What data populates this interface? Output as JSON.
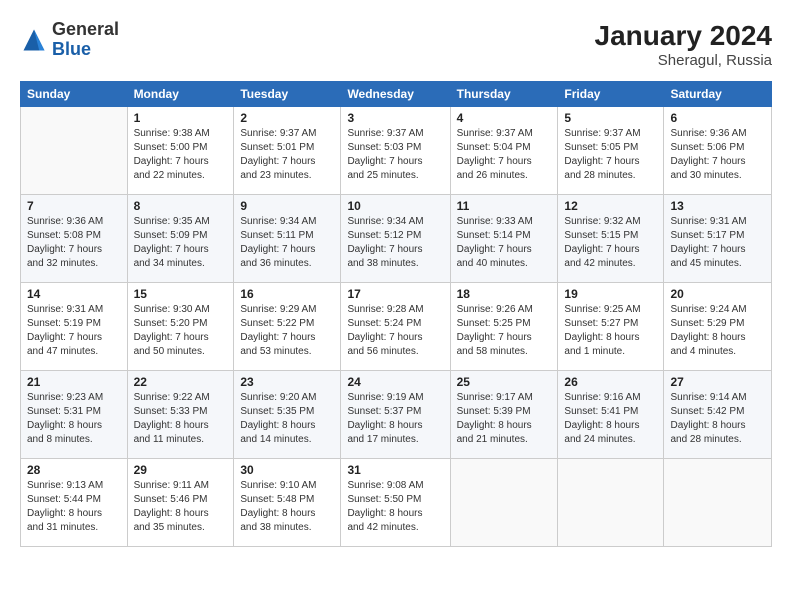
{
  "logo": {
    "general": "General",
    "blue": "Blue"
  },
  "title": "January 2024",
  "location": "Sheragul, Russia",
  "days_header": [
    "Sunday",
    "Monday",
    "Tuesday",
    "Wednesday",
    "Thursday",
    "Friday",
    "Saturday"
  ],
  "weeks": [
    [
      {
        "day": "",
        "info": ""
      },
      {
        "day": "1",
        "info": "Sunrise: 9:38 AM\nSunset: 5:00 PM\nDaylight: 7 hours\nand 22 minutes."
      },
      {
        "day": "2",
        "info": "Sunrise: 9:37 AM\nSunset: 5:01 PM\nDaylight: 7 hours\nand 23 minutes."
      },
      {
        "day": "3",
        "info": "Sunrise: 9:37 AM\nSunset: 5:03 PM\nDaylight: 7 hours\nand 25 minutes."
      },
      {
        "day": "4",
        "info": "Sunrise: 9:37 AM\nSunset: 5:04 PM\nDaylight: 7 hours\nand 26 minutes."
      },
      {
        "day": "5",
        "info": "Sunrise: 9:37 AM\nSunset: 5:05 PM\nDaylight: 7 hours\nand 28 minutes."
      },
      {
        "day": "6",
        "info": "Sunrise: 9:36 AM\nSunset: 5:06 PM\nDaylight: 7 hours\nand 30 minutes."
      }
    ],
    [
      {
        "day": "7",
        "info": "Sunrise: 9:36 AM\nSunset: 5:08 PM\nDaylight: 7 hours\nand 32 minutes."
      },
      {
        "day": "8",
        "info": "Sunrise: 9:35 AM\nSunset: 5:09 PM\nDaylight: 7 hours\nand 34 minutes."
      },
      {
        "day": "9",
        "info": "Sunrise: 9:34 AM\nSunset: 5:11 PM\nDaylight: 7 hours\nand 36 minutes."
      },
      {
        "day": "10",
        "info": "Sunrise: 9:34 AM\nSunset: 5:12 PM\nDaylight: 7 hours\nand 38 minutes."
      },
      {
        "day": "11",
        "info": "Sunrise: 9:33 AM\nSunset: 5:14 PM\nDaylight: 7 hours\nand 40 minutes."
      },
      {
        "day": "12",
        "info": "Sunrise: 9:32 AM\nSunset: 5:15 PM\nDaylight: 7 hours\nand 42 minutes."
      },
      {
        "day": "13",
        "info": "Sunrise: 9:31 AM\nSunset: 5:17 PM\nDaylight: 7 hours\nand 45 minutes."
      }
    ],
    [
      {
        "day": "14",
        "info": "Sunrise: 9:31 AM\nSunset: 5:19 PM\nDaylight: 7 hours\nand 47 minutes."
      },
      {
        "day": "15",
        "info": "Sunrise: 9:30 AM\nSunset: 5:20 PM\nDaylight: 7 hours\nand 50 minutes."
      },
      {
        "day": "16",
        "info": "Sunrise: 9:29 AM\nSunset: 5:22 PM\nDaylight: 7 hours\nand 53 minutes."
      },
      {
        "day": "17",
        "info": "Sunrise: 9:28 AM\nSunset: 5:24 PM\nDaylight: 7 hours\nand 56 minutes."
      },
      {
        "day": "18",
        "info": "Sunrise: 9:26 AM\nSunset: 5:25 PM\nDaylight: 7 hours\nand 58 minutes."
      },
      {
        "day": "19",
        "info": "Sunrise: 9:25 AM\nSunset: 5:27 PM\nDaylight: 8 hours\nand 1 minute."
      },
      {
        "day": "20",
        "info": "Sunrise: 9:24 AM\nSunset: 5:29 PM\nDaylight: 8 hours\nand 4 minutes."
      }
    ],
    [
      {
        "day": "21",
        "info": "Sunrise: 9:23 AM\nSunset: 5:31 PM\nDaylight: 8 hours\nand 8 minutes."
      },
      {
        "day": "22",
        "info": "Sunrise: 9:22 AM\nSunset: 5:33 PM\nDaylight: 8 hours\nand 11 minutes."
      },
      {
        "day": "23",
        "info": "Sunrise: 9:20 AM\nSunset: 5:35 PM\nDaylight: 8 hours\nand 14 minutes."
      },
      {
        "day": "24",
        "info": "Sunrise: 9:19 AM\nSunset: 5:37 PM\nDaylight: 8 hours\nand 17 minutes."
      },
      {
        "day": "25",
        "info": "Sunrise: 9:17 AM\nSunset: 5:39 PM\nDaylight: 8 hours\nand 21 minutes."
      },
      {
        "day": "26",
        "info": "Sunrise: 9:16 AM\nSunset: 5:41 PM\nDaylight: 8 hours\nand 24 minutes."
      },
      {
        "day": "27",
        "info": "Sunrise: 9:14 AM\nSunset: 5:42 PM\nDaylight: 8 hours\nand 28 minutes."
      }
    ],
    [
      {
        "day": "28",
        "info": "Sunrise: 9:13 AM\nSunset: 5:44 PM\nDaylight: 8 hours\nand 31 minutes."
      },
      {
        "day": "29",
        "info": "Sunrise: 9:11 AM\nSunset: 5:46 PM\nDaylight: 8 hours\nand 35 minutes."
      },
      {
        "day": "30",
        "info": "Sunrise: 9:10 AM\nSunset: 5:48 PM\nDaylight: 8 hours\nand 38 minutes."
      },
      {
        "day": "31",
        "info": "Sunrise: 9:08 AM\nSunset: 5:50 PM\nDaylight: 8 hours\nand 42 minutes."
      },
      {
        "day": "",
        "info": ""
      },
      {
        "day": "",
        "info": ""
      },
      {
        "day": "",
        "info": ""
      }
    ]
  ]
}
